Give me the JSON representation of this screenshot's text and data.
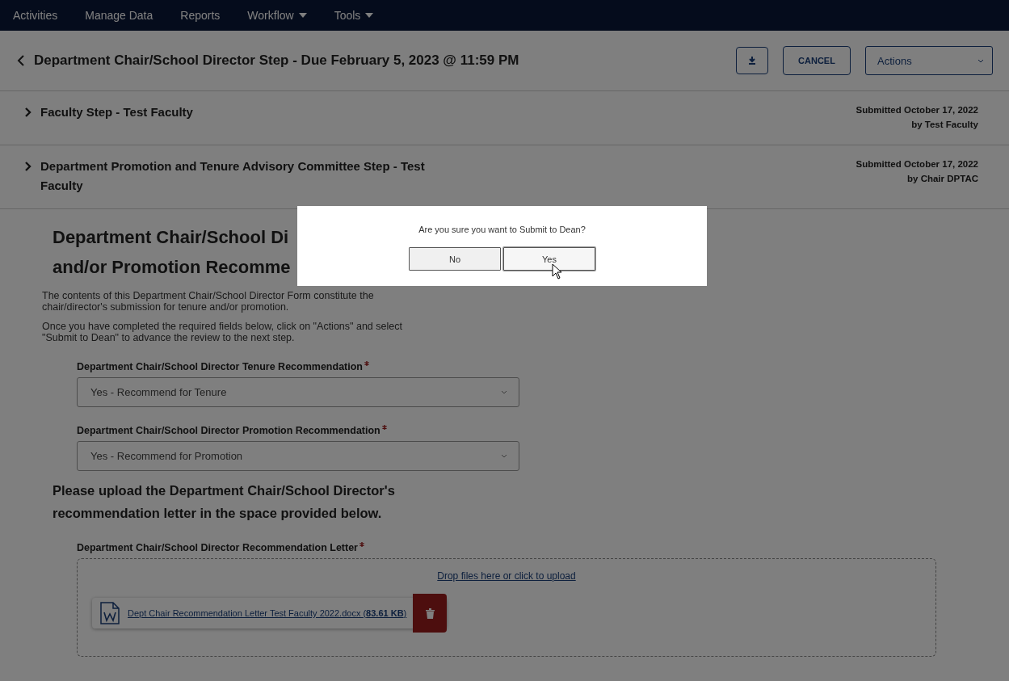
{
  "nav": {
    "items": [
      {
        "label": "Activities",
        "dropdown": false
      },
      {
        "label": "Manage Data",
        "dropdown": false
      },
      {
        "label": "Reports",
        "dropdown": false
      },
      {
        "label": "Workflow",
        "dropdown": true
      },
      {
        "label": "Tools",
        "dropdown": true
      }
    ]
  },
  "header": {
    "title": "Department Chair/School Director Step - Due February 5, 2023 @ 11:59 PM",
    "cancel": "CANCEL",
    "actions": "Actions"
  },
  "steps": [
    {
      "title": "Faculty Step - Test Faculty",
      "submitted": "Submitted October 17, 2022",
      "by": "by Test Faculty",
      "expanded": false
    },
    {
      "title": "Department Promotion and Tenure Advisory Committee Step - Test Faculty",
      "submitted": "Submitted October 17, 2022",
      "by": "by Chair DPTAC",
      "expanded": false
    }
  ],
  "form": {
    "heading_lines": [
      "Department Chair/School Di",
      "and/or Promotion Recomme"
    ],
    "paragraphs": [
      "The contents of this Department Chair/School Director Form constitute the chair/director's submission for tenure and/or promotion.",
      "Once you have completed the required fields below, click on \"Actions\" and select \"Submit to Dean\" to advance the review to the next step."
    ],
    "fields": [
      {
        "label": "Department Chair/School Director Tenure Recommendation",
        "required": true,
        "value": "Yes - Recommend for Tenure"
      },
      {
        "label": "Department Chair/School Director Promotion Recommendation",
        "required": true,
        "value": "Yes - Recommend for Promotion"
      }
    ],
    "upload_heading": "Please upload the Department Chair/School Director's recommendation letter in the space provided below.",
    "upload": {
      "label": "Department Chair/School Director Recommendation Letter",
      "required": true,
      "drop_text": "Drop files here or click to upload",
      "files": [
        {
          "name": "Dept Chair Recommendation Letter Test Faculty 2022.docx (**83.61 KB**)"
        }
      ]
    }
  },
  "dialog": {
    "message": "Are you sure you want to Submit to Dean?",
    "buttons": [
      {
        "label": "No",
        "hovered": false
      },
      {
        "label": "Yes",
        "hovered": true
      }
    ]
  }
}
